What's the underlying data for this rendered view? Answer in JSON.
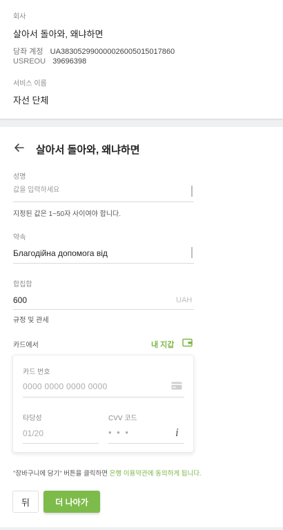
{
  "company": {
    "label": "회사",
    "name": "살아서 돌아와, 왜냐하면",
    "account_label": "당좌 계정",
    "account_value": "UA383052990000026005015017860",
    "usreou_label": "USREOU",
    "usreou_value": "39696398",
    "service_label": "서비스 이름",
    "service_value": "자선 단체"
  },
  "header": {
    "title": "살아서 돌아와, 왜냐하면"
  },
  "form": {
    "name_label": "성명",
    "name_placeholder": "값을 입력하세요",
    "name_hint": "지정된 값은 1~50자 사이여야 합니다.",
    "purpose_label": "약속",
    "purpose_value": "Благодійна допомога від",
    "amount_label": "합집합",
    "amount_value": "600",
    "amount_currency": "UAH",
    "rules_label": "규정 및 관세",
    "from_card_label": "카드에서",
    "wallet_label": "내 지갑"
  },
  "card": {
    "number_label": "카드 번호",
    "number_placeholder": "0000 0000 0000 0000",
    "expiry_label": "타당성",
    "expiry_placeholder": "01/20",
    "cvv_label": "CVV 코드",
    "cvv_placeholder": "• • •"
  },
  "terms": {
    "text": "\"장바구니에 담기\" 버튼을 클릭하면",
    "link": "은행 이용약관에 동의하게 됩니다."
  },
  "buttons": {
    "back": "뒤",
    "next": "더 나아가"
  },
  "colors": {
    "accent": "#7dbb4a",
    "background": "#eef0f2"
  }
}
